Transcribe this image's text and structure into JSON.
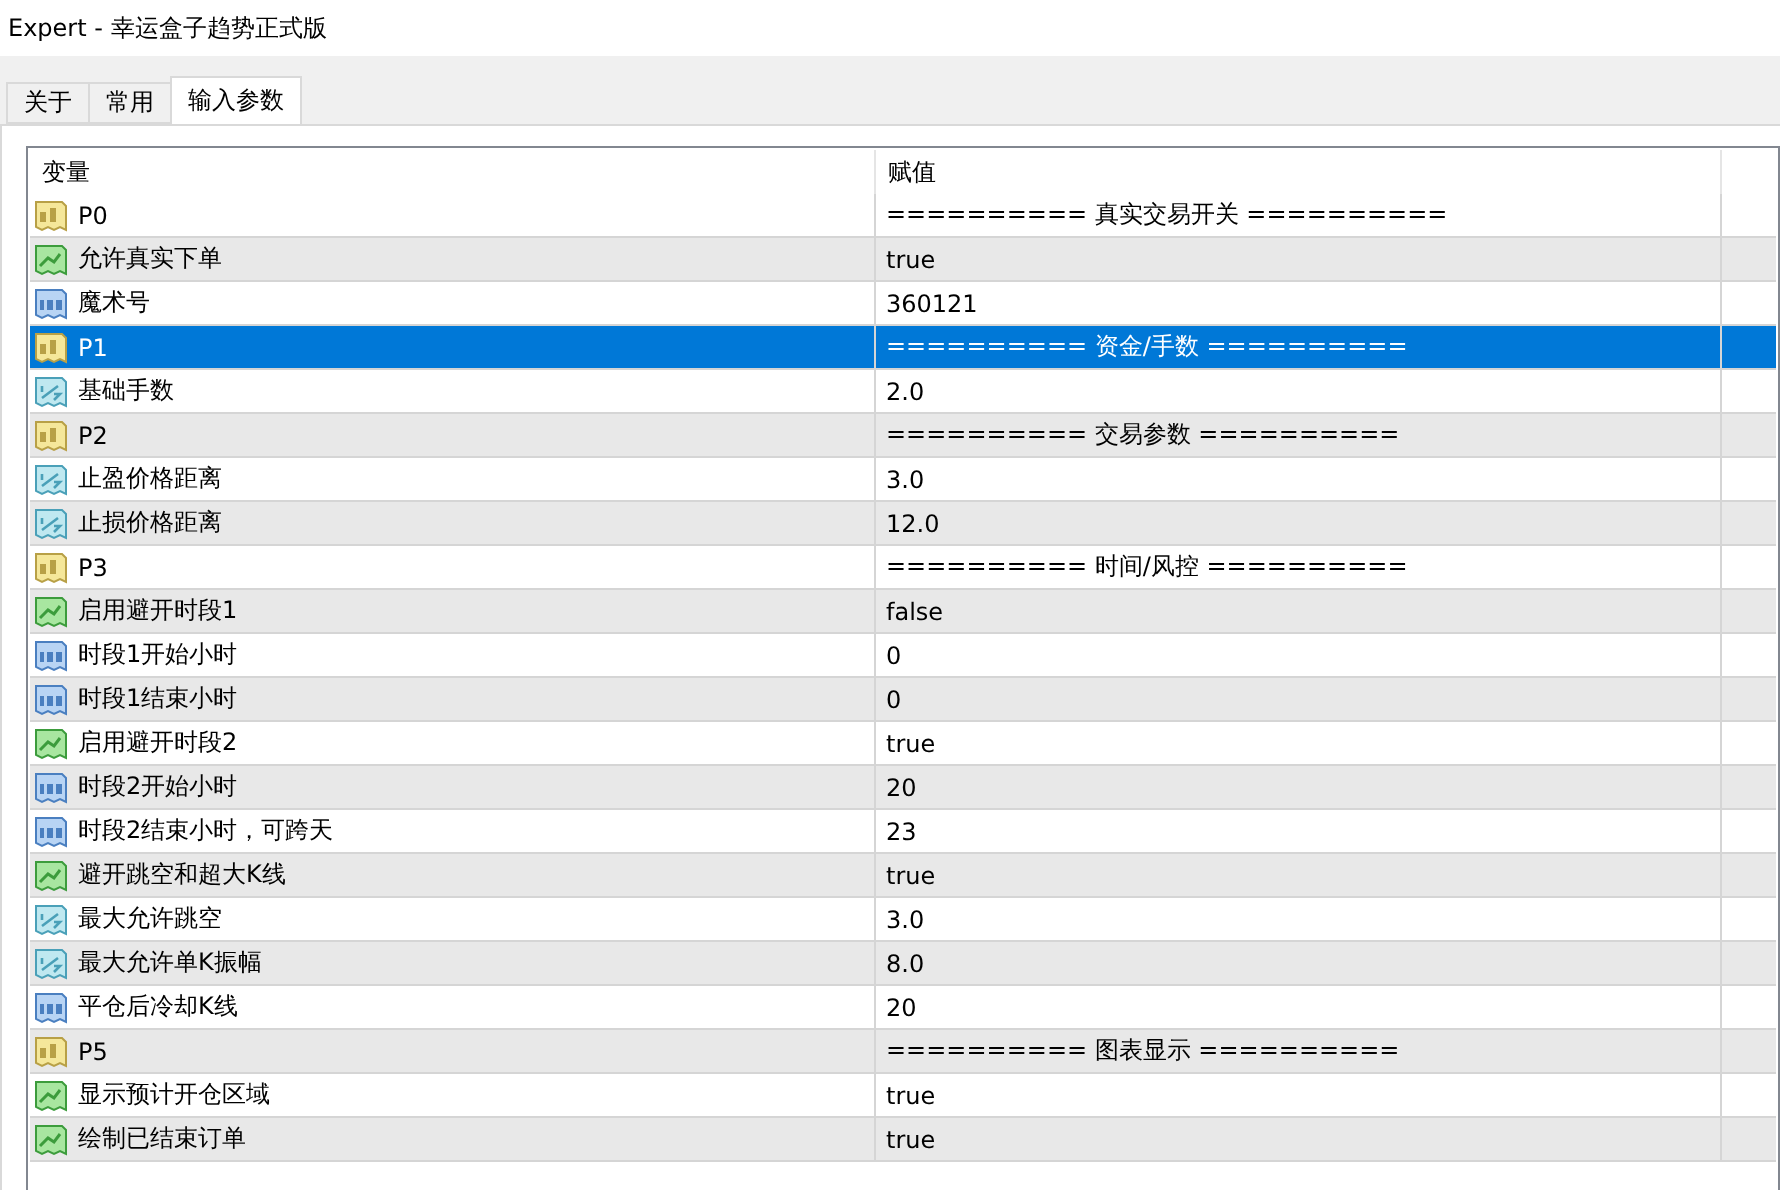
{
  "window": {
    "title": "Expert - 幸运盒子趋势正式版"
  },
  "tabs": [
    {
      "label": "关于",
      "selected": false
    },
    {
      "label": "常用",
      "selected": false
    },
    {
      "label": "输入参数",
      "selected": true
    }
  ],
  "table": {
    "columns": [
      "变量",
      "赋值"
    ],
    "rows": [
      {
        "kind": "string",
        "name": "P0",
        "value": "========== 真实交易开关 ==========",
        "selected": false
      },
      {
        "kind": "bool",
        "name": "允许真实下单",
        "value": "true",
        "selected": false
      },
      {
        "kind": "int",
        "name": "魔术号",
        "value": "360121",
        "selected": false
      },
      {
        "kind": "string",
        "name": "P1",
        "value": "========== 资金/手数 ==========",
        "selected": true
      },
      {
        "kind": "double",
        "name": "基础手数",
        "value": "2.0",
        "selected": false
      },
      {
        "kind": "string",
        "name": "P2",
        "value": "========== 交易参数 ==========",
        "selected": false
      },
      {
        "kind": "double",
        "name": "止盈价格距离",
        "value": "3.0",
        "selected": false
      },
      {
        "kind": "double",
        "name": "止损价格距离",
        "value": "12.0",
        "selected": false
      },
      {
        "kind": "string",
        "name": "P3",
        "value": "========== 时间/风控 ==========",
        "selected": false
      },
      {
        "kind": "bool",
        "name": "启用避开时段1",
        "value": "false",
        "selected": false
      },
      {
        "kind": "int",
        "name": "时段1开始小时",
        "value": "0",
        "selected": false
      },
      {
        "kind": "int",
        "name": "时段1结束小时",
        "value": "0",
        "selected": false
      },
      {
        "kind": "bool",
        "name": "启用避开时段2",
        "value": "true",
        "selected": false
      },
      {
        "kind": "int",
        "name": "时段2开始小时",
        "value": "20",
        "selected": false
      },
      {
        "kind": "int",
        "name": "时段2结束小时，可跨天",
        "value": "23",
        "selected": false
      },
      {
        "kind": "bool",
        "name": "避开跳空和超大K线",
        "value": "true",
        "selected": false
      },
      {
        "kind": "double",
        "name": "最大允许跳空",
        "value": "3.0",
        "selected": false
      },
      {
        "kind": "double",
        "name": "最大允许单K振幅",
        "value": "8.0",
        "selected": false
      },
      {
        "kind": "int",
        "name": "平仓后冷却K线",
        "value": "20",
        "selected": false
      },
      {
        "kind": "string",
        "name": "P5",
        "value": "========== 图表显示 ==========",
        "selected": false
      },
      {
        "kind": "bool",
        "name": "显示预计开仓区域",
        "value": "true",
        "selected": false
      },
      {
        "kind": "bool",
        "name": "绘制已结束订单",
        "value": "true",
        "selected": false
      }
    ]
  }
}
